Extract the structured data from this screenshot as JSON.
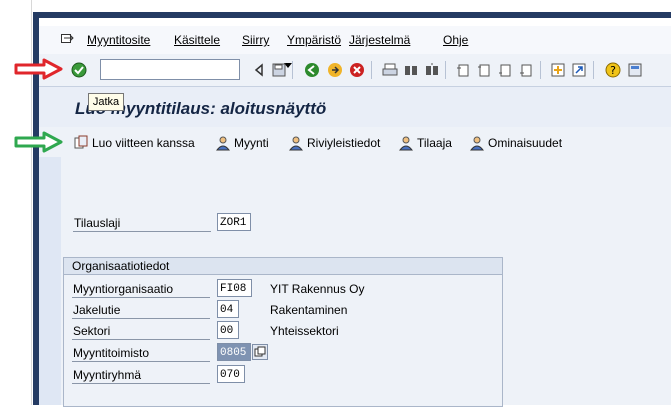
{
  "menu": {
    "items": [
      "Myyntitosite",
      "Käsittele",
      "Siirry",
      "Ympäristö",
      "Järjestelmä",
      "Ohje"
    ]
  },
  "toolbar": {
    "command_value": "",
    "icons": [
      "enter-icon",
      "back-icon",
      "save-icon",
      "green-back-icon",
      "exit-icon",
      "cancel-icon",
      "print-icon",
      "find-icon",
      "find-next-icon",
      "first-page-icon",
      "prev-page-icon",
      "next-page-icon",
      "last-page-icon",
      "new-session-icon",
      "shortcut-icon",
      "help-icon",
      "layout-icon"
    ]
  },
  "tooltip": {
    "text": "Jatka"
  },
  "title": {
    "text": "Luo myyntitilaus: aloitusnäyttö"
  },
  "app_toolbar": {
    "buttons": [
      {
        "label": "Luo viitteen kanssa",
        "icon": "copy-reference-icon"
      },
      {
        "label": "Myynti",
        "icon": "person-icon"
      },
      {
        "label": "Riviyleistiedot",
        "icon": "person-icon"
      },
      {
        "label": "Tilaaja",
        "icon": "person-icon"
      },
      {
        "label": "Ominaisuudet",
        "icon": "person-icon"
      }
    ]
  },
  "form": {
    "order_type": {
      "label": "Tilauslaji",
      "value": "ZOR1"
    },
    "org_group_title": "Organisaatiotiedot",
    "rows": [
      {
        "label": "Myyntiorganisaatio",
        "value": "FI08",
        "desc": "YIT Rakennus Oy"
      },
      {
        "label": "Jakelutie",
        "value": "04",
        "desc": "Rakentaminen"
      },
      {
        "label": "Sektori",
        "value": "00",
        "desc": "Yhteissektori"
      },
      {
        "label": "Myyntitoimisto",
        "value": "0805",
        "desc": ""
      },
      {
        "label": "Myyntiryhmä",
        "value": "070",
        "desc": ""
      }
    ]
  },
  "colors": {
    "red_arrow": "#e0262b",
    "green_arrow": "#2fa84f",
    "frame": "#243b63"
  }
}
